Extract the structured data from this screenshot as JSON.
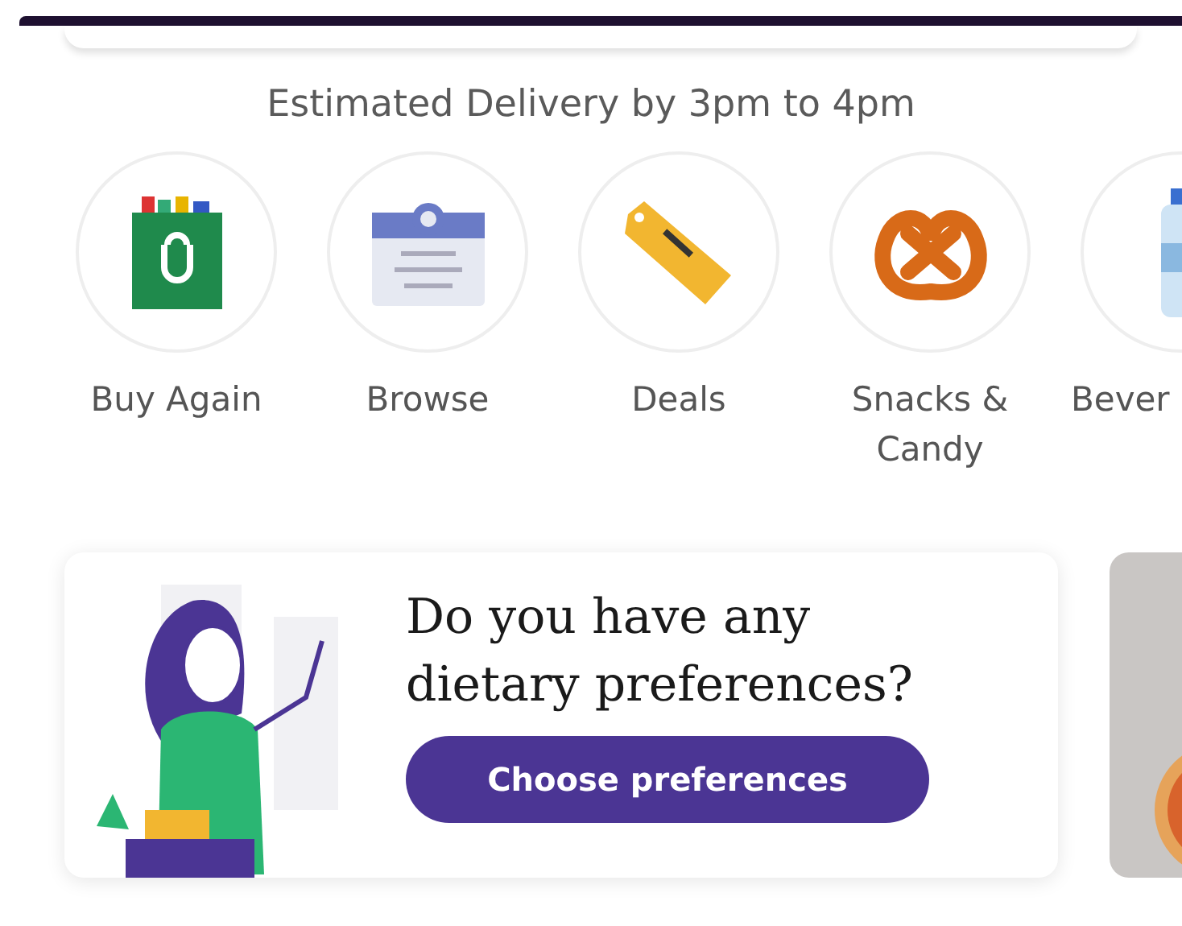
{
  "delivery_estimate": "Estimated Delivery by 3pm to 4pm",
  "categories": [
    {
      "label": "Buy Again"
    },
    {
      "label": "Browse"
    },
    {
      "label": "Deals"
    },
    {
      "label": "Snacks &\nCandy"
    },
    {
      "label": "Bever"
    }
  ],
  "promo_card": {
    "title": "Do you have any dietary preferences?",
    "button": "Choose preferences"
  }
}
